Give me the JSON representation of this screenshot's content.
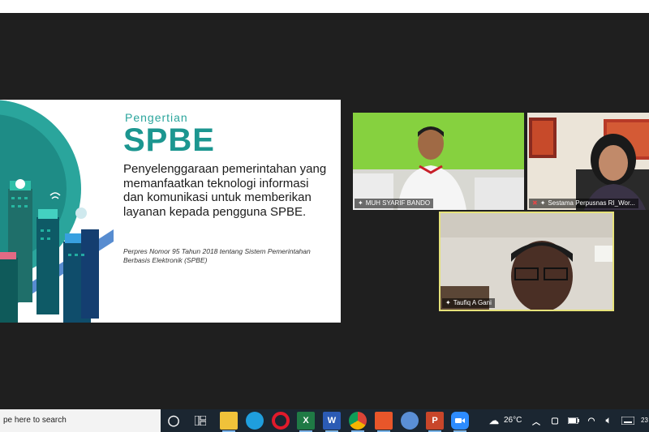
{
  "slide": {
    "subtitle": "Pengertian",
    "title": "SPBE",
    "body": "Penyelenggaraan pemerintahan yang memanfaatkan teknologi informasi dan komunikasi untuk memberikan layanan kepada pengguna SPBE.",
    "reference": "Perpres Nomor 95 Tahun 2018 tentang Sistem Pemerintahan Berbasis Elektronik (SPBE)"
  },
  "participants": [
    {
      "name": "MUH SYARIF BANDO",
      "active": false
    },
    {
      "name": "Sestama Perpusnas RI_Wor...",
      "active": false
    },
    {
      "name": "Taufiq A Gani",
      "active": true
    }
  ],
  "taskbar": {
    "search_placeholder": "pe here to search",
    "apps": [
      "File Explorer",
      "Edge",
      "Opera",
      "Excel",
      "Word",
      "Chrome",
      "App",
      "App",
      "PowerPoint",
      "Zoom"
    ],
    "weather": "26°C",
    "clock_partial": "23"
  },
  "colors": {
    "active_speaker_border": "#e6e27a",
    "slide_accent": "#1c9690"
  }
}
